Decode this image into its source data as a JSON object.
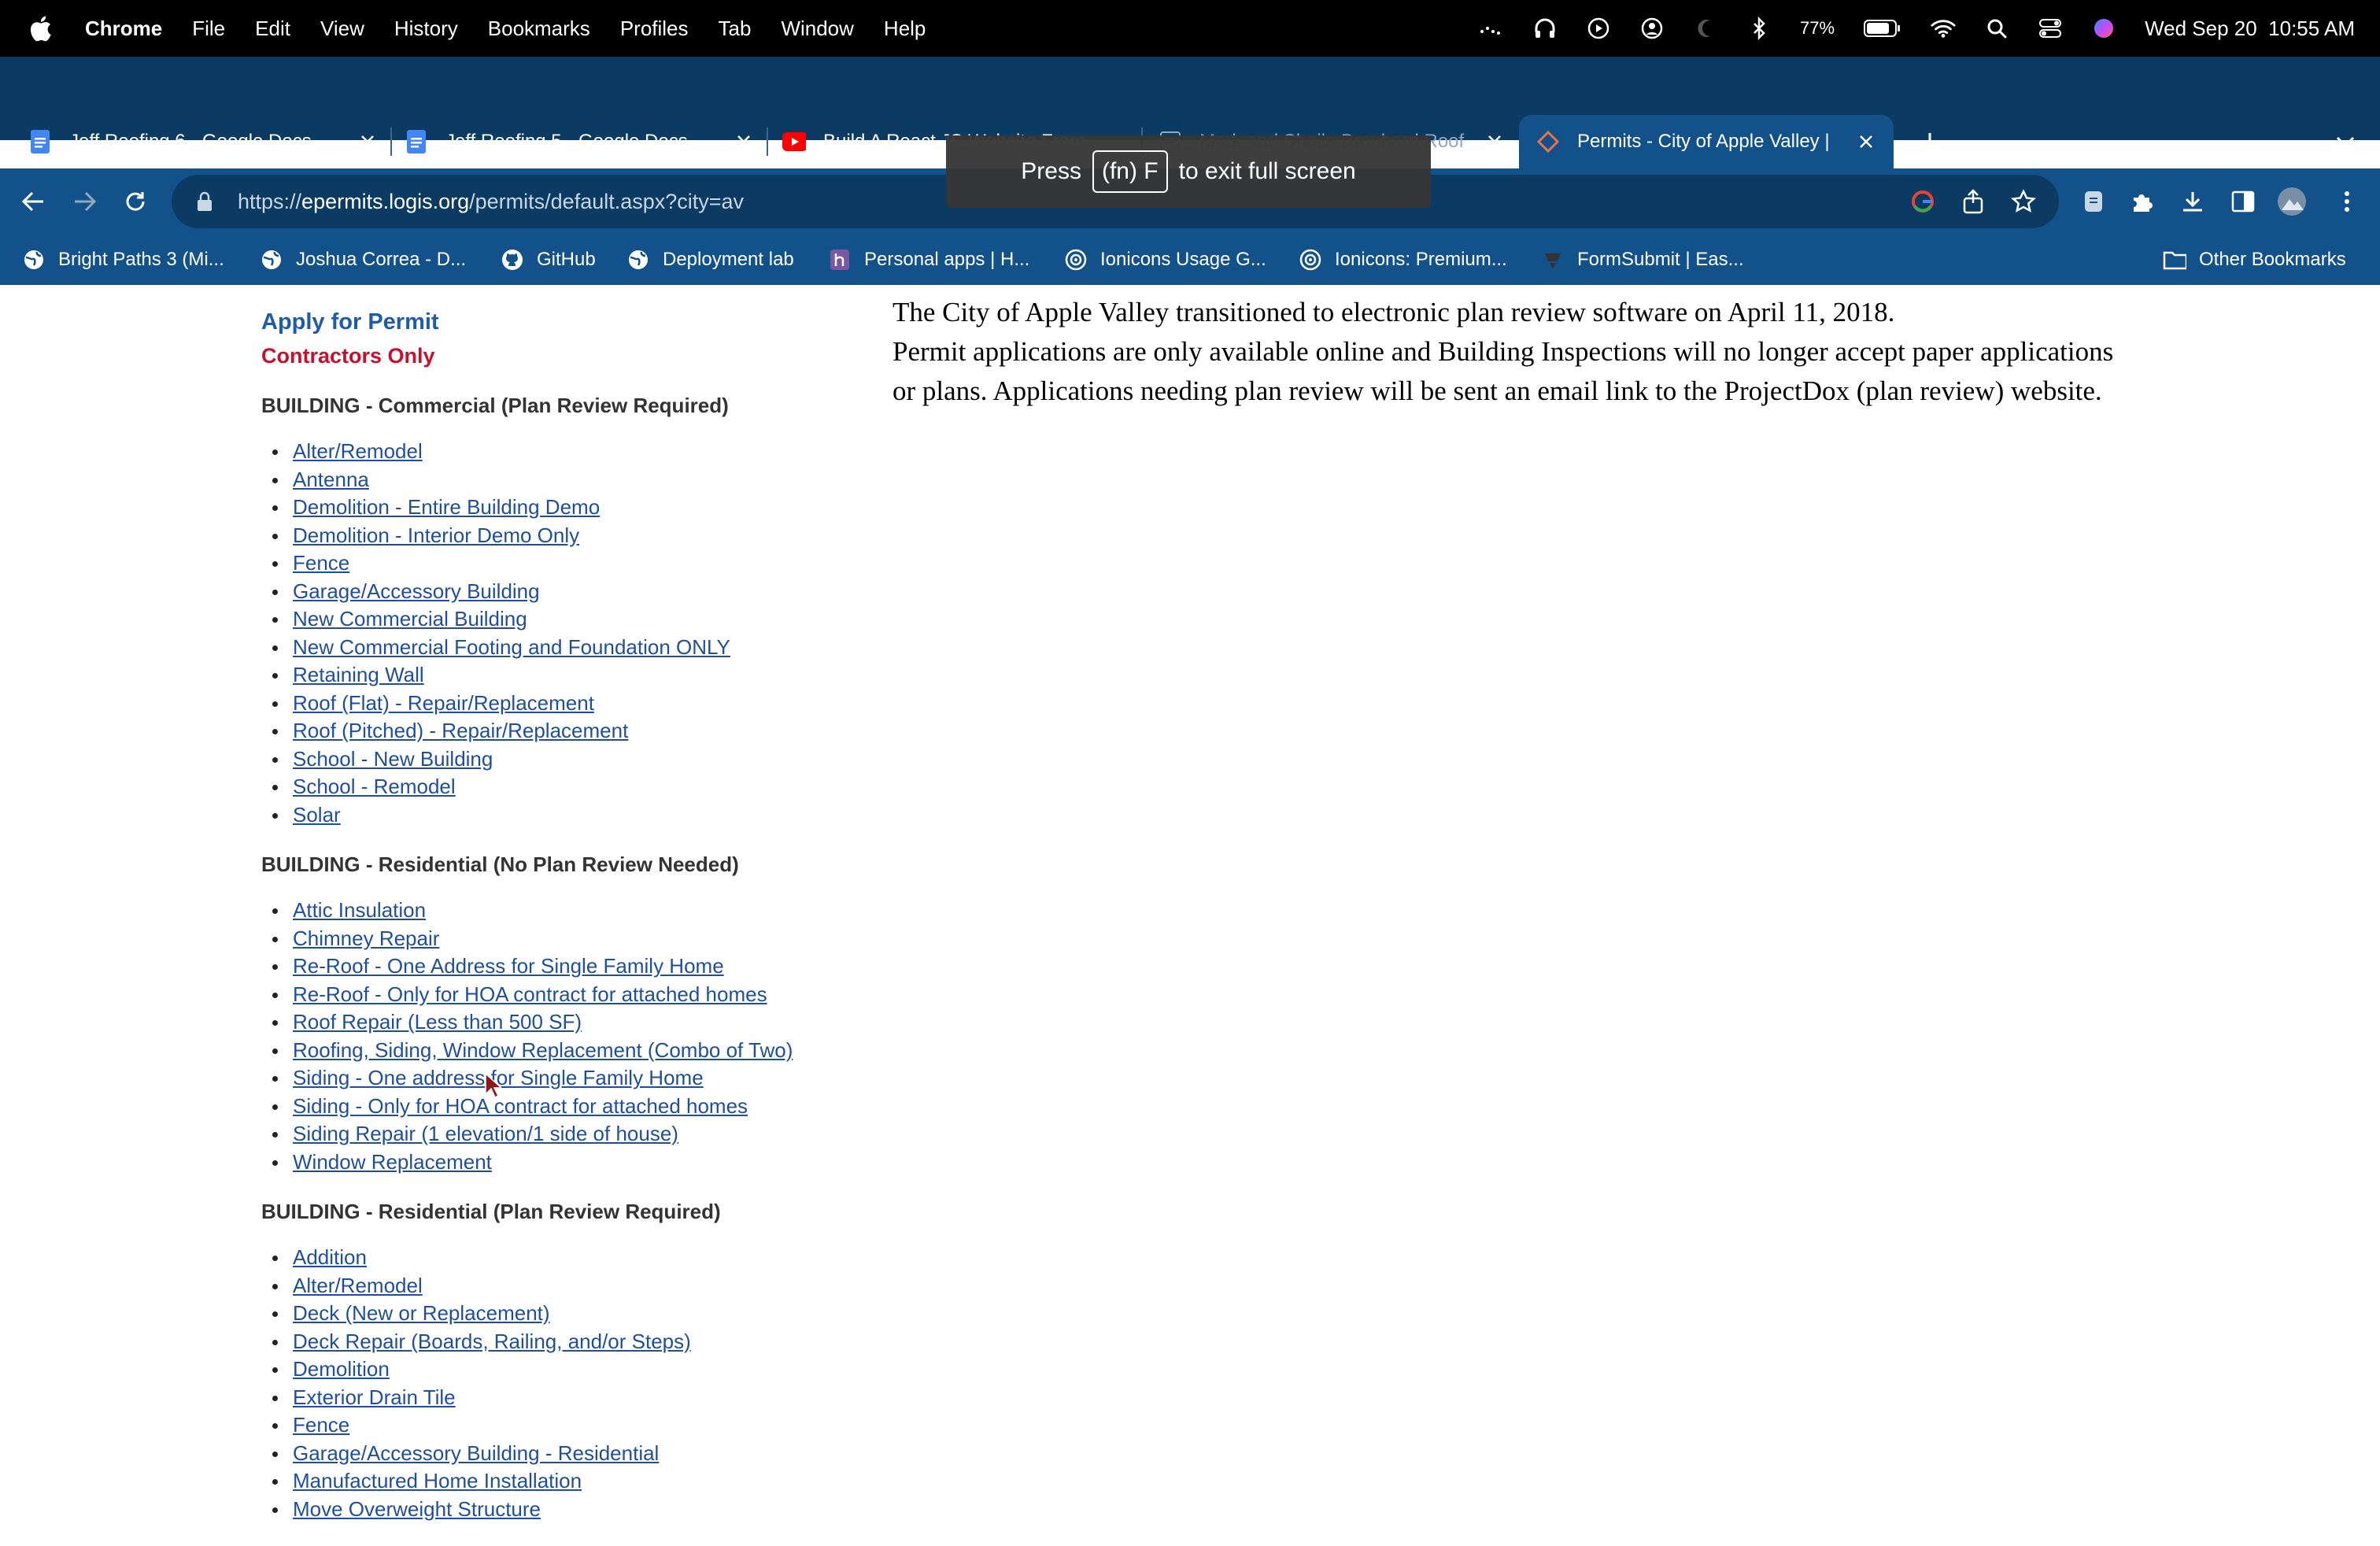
{
  "menubar": {
    "app": "Chrome",
    "items": [
      "File",
      "Edit",
      "View",
      "History",
      "Bookmarks",
      "Profiles",
      "Tab",
      "Window",
      "Help"
    ],
    "battery_percent": "77%",
    "datetime": "Wed Sep 20  10:55 AM"
  },
  "tabs": [
    {
      "title": "Jeff Roofing 6 - Google Docs",
      "icon": "google-docs-icon"
    },
    {
      "title": "Jeff Roofing 5 - Google Docs",
      "icon": "google-docs-icon"
    },
    {
      "title": "Build A React JS Website From",
      "icon": "youtube-icon"
    },
    {
      "title": "Mark and Sheila Brouhard Roof",
      "icon": "document-icon"
    },
    {
      "title": "Permits - City of Apple Valley |",
      "icon": "permits-icon"
    }
  ],
  "fullscreen_hint": {
    "before": "Press",
    "key": "(fn) F",
    "after": "to exit full screen"
  },
  "address": {
    "scheme": "https://",
    "host": "epermits.logis.org",
    "path": "/permits/default.aspx?city=av"
  },
  "bookmarks": [
    {
      "label": "Bright Paths 3 (Mi...",
      "icon": "globe-icon"
    },
    {
      "label": "Joshua Correa - D...",
      "icon": "globe-icon"
    },
    {
      "label": "GitHub",
      "icon": "github-icon"
    },
    {
      "label": "Deployment lab",
      "icon": "globe-icon"
    },
    {
      "label": "Personal apps | H...",
      "icon": "heroku-icon"
    },
    {
      "label": "Ionicons Usage G...",
      "icon": "ionicons-icon"
    },
    {
      "label": "Ionicons: Premium...",
      "icon": "ionicons-icon"
    },
    {
      "label": "FormSubmit | Eas...",
      "icon": "formsubmit-icon"
    }
  ],
  "other_bookmarks": "Other Bookmarks",
  "sidebar": {
    "title": "Apply for Permit",
    "subtitle": "Contractors Only",
    "sections": [
      {
        "heading": "BUILDING - Commercial (Plan Review Required)",
        "items": [
          "Alter/Remodel",
          "Antenna",
          "Demolition - Entire Building Demo",
          "Demolition - Interior Demo Only",
          "Fence",
          "Garage/Accessory Building",
          "New Commercial Building",
          "New Commercial Footing and Foundation ONLY",
          "Retaining Wall",
          "Roof (Flat) - Repair/Replacement",
          "Roof (Pitched) - Repair/Replacement",
          "School - New Building",
          "School - Remodel",
          "Solar"
        ]
      },
      {
        "heading": "BUILDING - Residential (No Plan Review Needed)",
        "items": [
          "Attic Insulation",
          "Chimney Repair",
          "Re-Roof - One Address for Single Family Home",
          "Re-Roof - Only for HOA contract for attached homes",
          "Roof Repair (Less than 500 SF)",
          "Roofing, Siding, Window Replacement (Combo of Two)",
          "Siding - One address for Single Family Home",
          "Siding - Only for HOA contract for attached homes",
          "Siding Repair (1 elevation/1 side of house)",
          "Window Replacement"
        ]
      },
      {
        "heading": "BUILDING - Residential (Plan Review Required)",
        "items": [
          "Addition",
          "Alter/Remodel",
          "Deck (New or Replacement)",
          "Deck Repair (Boards, Railing, and/or Steps)",
          "Demolition",
          "Exterior Drain Tile",
          "Fence",
          "Garage/Accessory Building - Residential",
          "Manufactured Home Installation",
          "Move Overweight Structure"
        ]
      }
    ]
  },
  "notice": {
    "line1": "The City of Apple Valley transitioned to electronic plan review software on April 11, 2018.",
    "line2": "Permit applications are only available online and Building Inspections will no longer accept paper applications or plans.  Applications needing plan review will be sent an email link to the ProjectDox (plan review) website."
  }
}
